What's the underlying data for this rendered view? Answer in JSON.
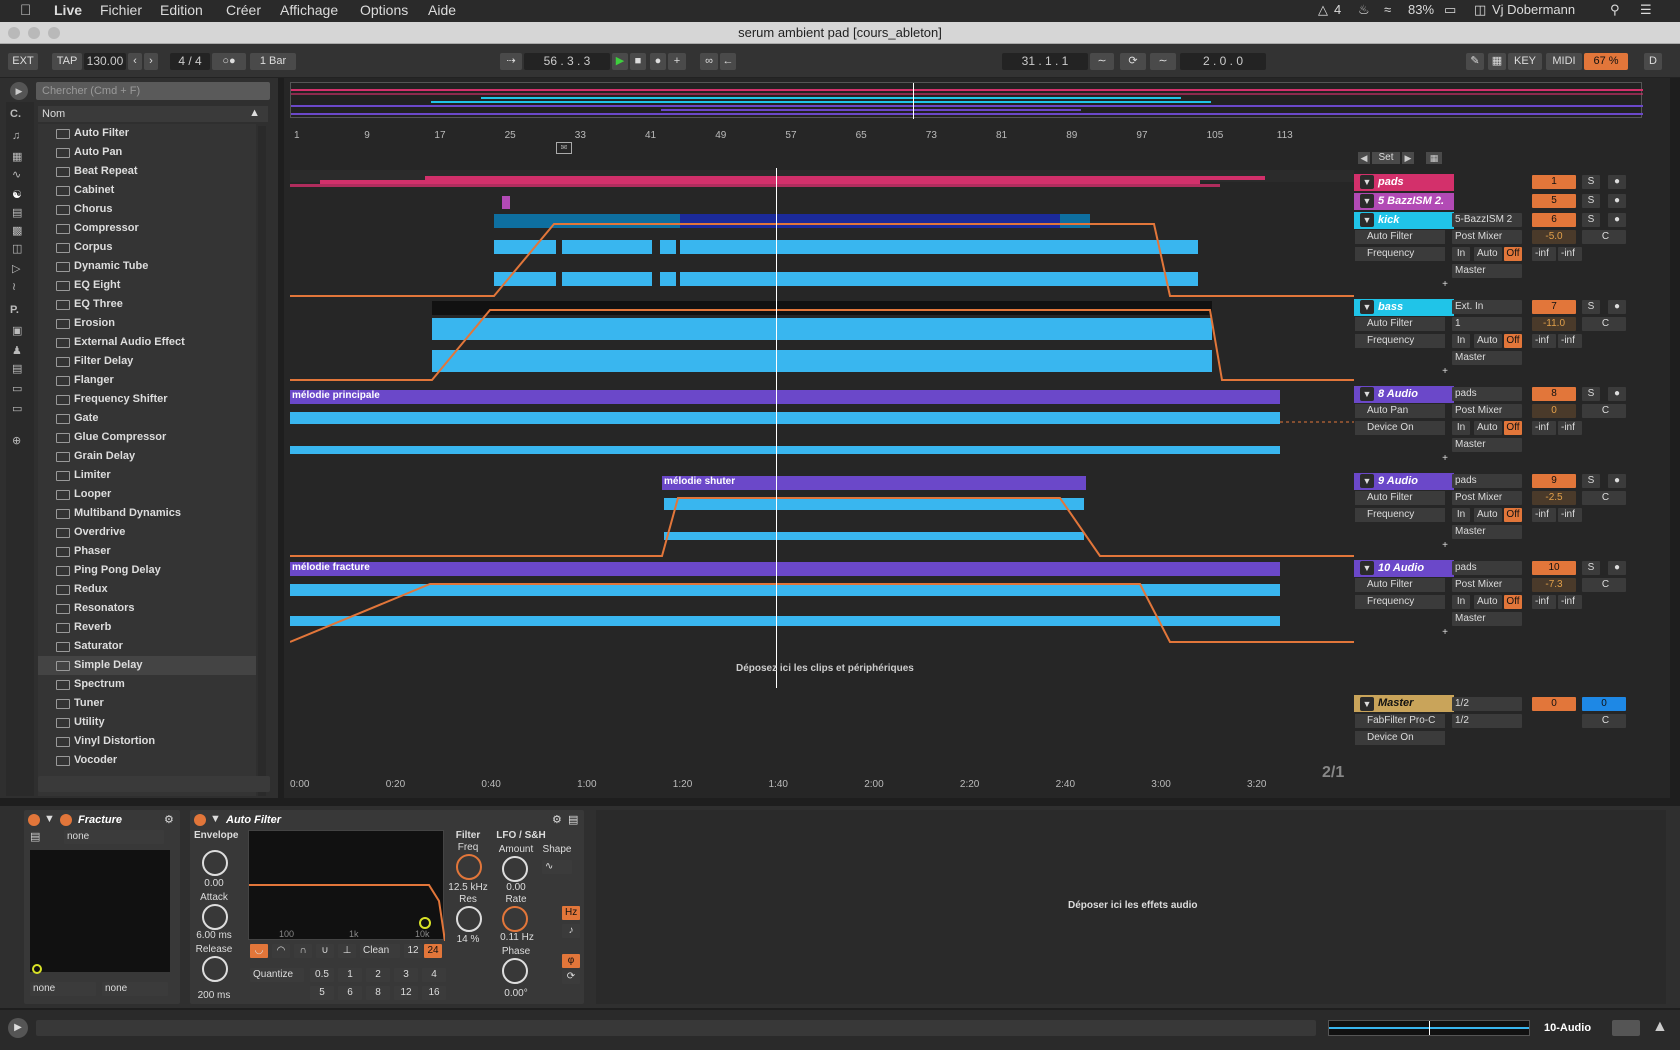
{
  "menubar": {
    "app": "Live",
    "items": [
      "Fichier",
      "Edition",
      "Créer",
      "Affichage",
      "Options",
      "Aide"
    ],
    "badge_count": "4",
    "battery": "83%",
    "user": "Vj Dobermann"
  },
  "window": {
    "title": "serum ambient pad  [cours_ableton]"
  },
  "control": {
    "ext": "EXT",
    "tap": "TAP",
    "tempo": "130.00",
    "signature": "4 / 4",
    "quantize": "1 Bar",
    "position": "56 .  3 .  3",
    "loop_start": "31 .  1 .  1",
    "loop_length": "2 .  0 .  0",
    "key": "KEY",
    "midi": "MIDI",
    "cpu": "67 %",
    "d": "D"
  },
  "browser": {
    "search_placeholder": "Chercher (Cmd + F)",
    "col_header": "Nom",
    "side_labels": [
      "C.",
      "P."
    ],
    "items": [
      "Auto Filter",
      "Auto Pan",
      "Beat Repeat",
      "Cabinet",
      "Chorus",
      "Compressor",
      "Corpus",
      "Dynamic Tube",
      "EQ Eight",
      "EQ Three",
      "Erosion",
      "External Audio Effect",
      "Filter Delay",
      "Flanger",
      "Frequency Shifter",
      "Gate",
      "Glue Compressor",
      "Grain Delay",
      "Limiter",
      "Looper",
      "Multiband Dynamics",
      "Overdrive",
      "Phaser",
      "Ping Pong Delay",
      "Redux",
      "Resonators",
      "Reverb",
      "Saturator",
      "Simple Delay",
      "Spectrum",
      "Tuner",
      "Utility",
      "Vinyl Distortion",
      "Vocoder"
    ],
    "selected": "Simple Delay"
  },
  "ruler": {
    "bars": [
      "1",
      "9",
      "17",
      "25",
      "33",
      "41",
      "49",
      "57",
      "65",
      "73",
      "81",
      "89",
      "97",
      "105",
      "113"
    ]
  },
  "set_label": "Set",
  "time": {
    "marks": [
      "0:00",
      "0:20",
      "0:40",
      "1:00",
      "1:20",
      "1:40",
      "2:00",
      "2:20",
      "2:40",
      "3:00",
      "3:20"
    ],
    "page": "2/1"
  },
  "drop_hint": "Déposez ici les clips et périphériques",
  "tracks": [
    {
      "name": "pads",
      "color": "#d3306b",
      "num": "1",
      "solo": "S"
    },
    {
      "name": "5 BazzISM 2.",
      "color": "#b24ab5",
      "num": "5",
      "solo": "S"
    },
    {
      "name": "kick",
      "color": "#20c4e8",
      "num": "6",
      "solo": "S",
      "input": "5-BazzISM 2",
      "routing": "Post Mixer",
      "vol": "-5.0",
      "pan": "C",
      "dev1": "Auto Filter",
      "dev2": "Frequency",
      "out": "Master"
    },
    {
      "name": "bass",
      "color": "#20c4e8",
      "num": "7",
      "solo": "S",
      "input": "Ext. In",
      "routing": "1",
      "vol": "-11.0",
      "pan": "C",
      "dev1": "Auto Filter",
      "dev2": "Frequency",
      "out": "Master"
    },
    {
      "name": "8 Audio",
      "color": "#6b48c9",
      "num": "8",
      "solo": "S",
      "input": "pads",
      "routing": "Post Mixer",
      "vol": "0",
      "pan": "C",
      "dev1": "Auto Pan",
      "dev2": "Device On",
      "out": "Master",
      "clip": "mélodie principale"
    },
    {
      "name": "9 Audio",
      "color": "#6b48c9",
      "num": "9",
      "solo": "S",
      "input": "pads",
      "routing": "Post Mixer",
      "vol": "-2.5",
      "pan": "C",
      "dev1": "Auto Filter",
      "dev2": "Frequency",
      "out": "Master",
      "clip": "mélodie shuter"
    },
    {
      "name": "10 Audio",
      "color": "#6b48c9",
      "num": "10",
      "solo": "S",
      "input": "pads",
      "routing": "Post Mixer",
      "vol": "-7.3",
      "pan": "C",
      "dev1": "Auto Filter",
      "dev2": "Frequency",
      "out": "Master",
      "clip": "mélodie fracture"
    }
  ],
  "mixer_labels": {
    "in": "In",
    "auto": "Auto",
    "off": "Off",
    "inf": "-inf"
  },
  "master": {
    "name": "Master",
    "out1": "1/2",
    "out2": "1/2",
    "vol": "0",
    "num": "0",
    "pan": "C",
    "dev1": "FabFilter Pro-C",
    "dev2": "Device On"
  },
  "devices": {
    "fracture": {
      "title": "Fracture",
      "preset": "none",
      "sel1": "none",
      "sel2": "none"
    },
    "autofilter": {
      "title": "Auto Filter",
      "envelope": "Envelope",
      "env_val": "0.00",
      "attack": "Attack",
      "attack_val": "6.00 ms",
      "release": "Release",
      "release_val": "200 ms",
      "filter": "Filter",
      "freq": "Freq",
      "freq_val": "12.5 kHz",
      "res": "Res",
      "res_val": "14 %",
      "lfo": "LFO / S&H",
      "amount": "Amount",
      "amount_val": "0.00",
      "shape": "Shape",
      "rate": "Rate",
      "rate_val": "0.11 Hz",
      "phase": "Phase",
      "phase_val": "0.00°",
      "hz": "Hz",
      "clean": "Clean",
      "n12": "12",
      "n24": "24",
      "quantize": "Quantize",
      "qvals": [
        "0.5",
        "1",
        "2",
        "3",
        "4",
        "5",
        "6",
        "8",
        "12",
        "16"
      ],
      "graph_ticks": [
        "100",
        "1k",
        "10k"
      ]
    },
    "drop_effects": "Déposer ici les effets audio"
  },
  "status": {
    "track": "10-Audio"
  }
}
